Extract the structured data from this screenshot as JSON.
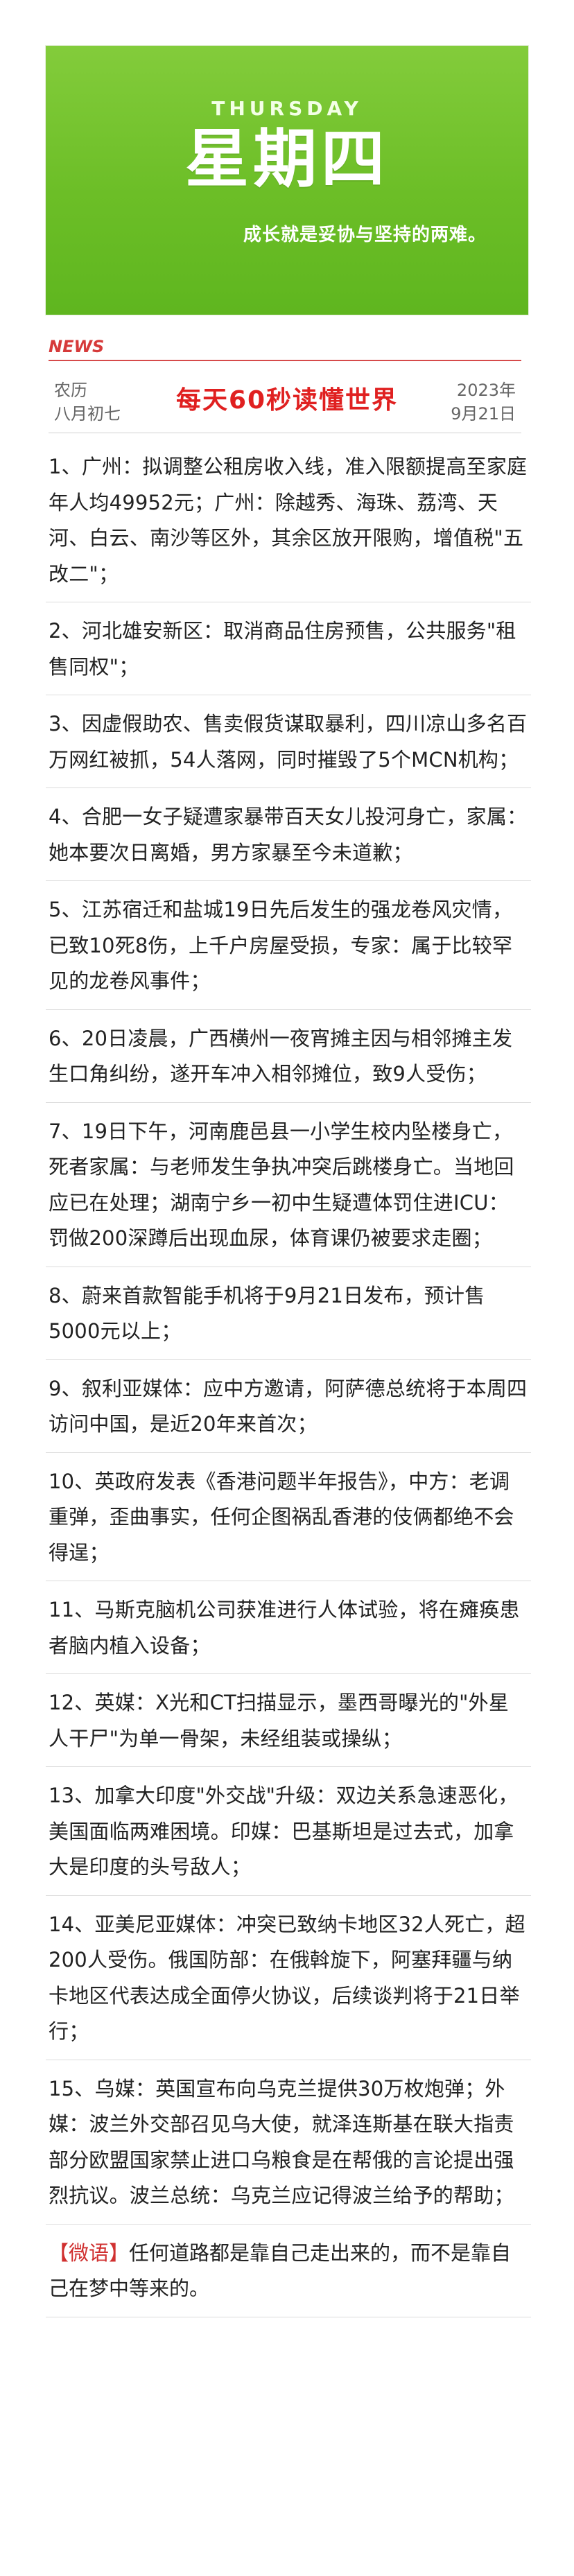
{
  "header": {
    "weekday_en": "THURSDAY",
    "weekday_cn": "星期四",
    "motto": "成长就是妥协与坚持的两难。"
  },
  "news_bar": {
    "tag": "NEWS",
    "lunar_label": "农历",
    "lunar_date": "八月初七",
    "title": "每天60秒读懂世界",
    "year": "2023年",
    "date": "9月21日"
  },
  "news_items": [
    "1、广州：拟调整公租房收入线，准入限额提高至家庭年人均49952元；广州：除越秀、海珠、荔湾、天河、白云、南沙等区外，其余区放开限购，增值税\"五改二\"；",
    "2、河北雄安新区：取消商品住房预售，公共服务\"租售同权\"；",
    "3、因虚假助农、售卖假货谋取暴利，四川凉山多名百万网红被抓，54人落网，同时摧毁了5个MCN机构；",
    "4、合肥一女子疑遭家暴带百天女儿投河身亡，家属：她本要次日离婚，男方家暴至今未道歉；",
    "5、江苏宿迁和盐城19日先后发生的强龙卷风灾情，已致10死8伤，上千户房屋受损，专家：属于比较罕见的龙卷风事件；",
    "6、20日凌晨，广西横州一夜宵摊主因与相邻摊主发生口角纠纷，遂开车冲入相邻摊位，致9人受伤；",
    "7、19日下午，河南鹿邑县一小学生校内坠楼身亡，死者家属：与老师发生争执冲突后跳楼身亡。当地回应已在处理；湖南宁乡一初中生疑遭体罚住进ICU：罚做200深蹲后出现血尿，体育课仍被要求走圈；",
    "8、蔚来首款智能手机将于9月21日发布，预计售5000元以上；",
    "9、叙利亚媒体：应中方邀请，阿萨德总统将于本周四访问中国，是近20年来首次；",
    "10、英政府发表《香港问题半年报告》，中方：老调重弹，歪曲事实，任何企图祸乱香港的伎俩都绝不会得逞；",
    "11、马斯克脑机公司获准进行人体试验，将在瘫痪患者脑内植入设备；",
    "12、英媒：X光和CT扫描显示，墨西哥曝光的\"外星人干尸\"为单一骨架，未经组装或操纵；",
    "13、加拿大印度\"外交战\"升级：双边关系急速恶化，美国面临两难困境。印媒：巴基斯坦是过去式，加拿大是印度的头号敌人；",
    "14、亚美尼亚媒体：冲突已致纳卡地区32人死亡，超200人受伤。俄国防部：在俄斡旋下，阿塞拜疆与纳卡地区代表达成全面停火协议，后续谈判将于21日举行；",
    "15、乌媒：英国宣布向乌克兰提供30万枚炮弹；外媒：波兰外交部召见乌大使，就泽连斯基在联大指责部分欧盟国家禁止进口乌粮食是在帮俄的言论提出强烈抗议。波兰总统：乌克兰应记得波兰给予的帮助；"
  ],
  "proverb": {
    "tag": "【微语】",
    "text": "任何道路都是靠自己走出来的，而不是靠自己在梦中等来的。"
  }
}
